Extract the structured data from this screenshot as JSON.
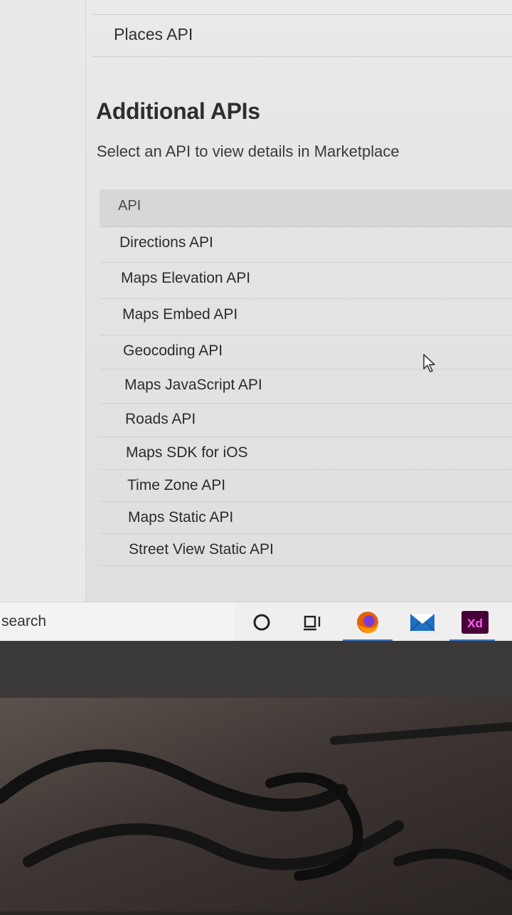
{
  "top_list": {
    "last_item": "Places API"
  },
  "additional_apis": {
    "title": "Additional APIs",
    "subtitle": "Select an API to view details in Marketplace",
    "column_header": "API",
    "rows": [
      "Directions API",
      "Maps Elevation API",
      "Maps Embed API",
      "Geocoding API",
      "Maps JavaScript API",
      "Roads API",
      "Maps SDK for iOS",
      "Time Zone API",
      "Maps Static API",
      "Street View Static API"
    ]
  },
  "taskbar": {
    "search_label": "search",
    "icons": [
      "cortana-circle-icon",
      "task-view-icon",
      "firefox-icon",
      "mail-icon",
      "adobe-xd-icon"
    ],
    "xd_label": "Xd",
    "colors": {
      "firefox": "#e66000",
      "mail": "#1f6fc4",
      "xd_bg": "#470137",
      "xd_text": "#ff61f6",
      "active_indicator": "#3a78c8"
    }
  }
}
